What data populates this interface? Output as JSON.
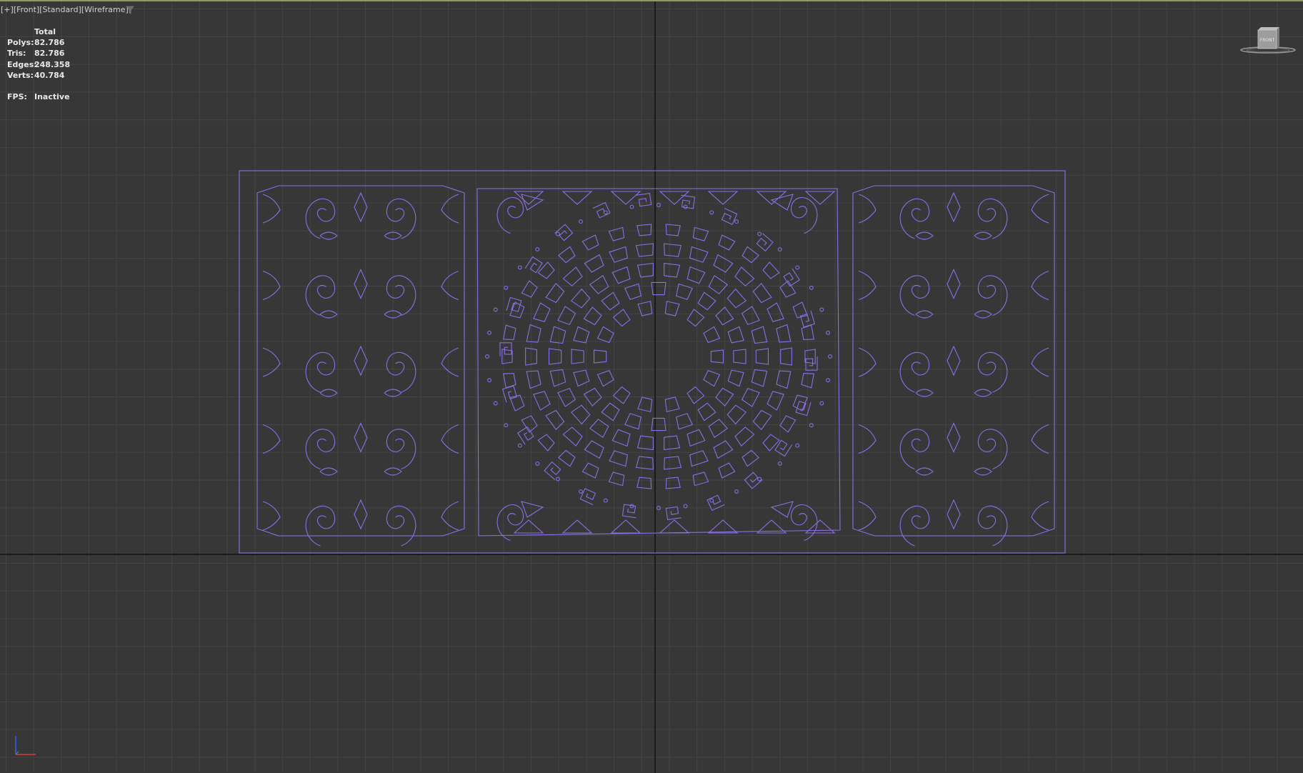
{
  "viewport": {
    "labels": [
      "[+]",
      "[Front]",
      "[Standard]",
      "[Wireframe]"
    ],
    "filter_icon": "funnel-icon"
  },
  "stats": {
    "header": "Total",
    "rows": [
      {
        "label": "Polys:",
        "value": "82.786"
      },
      {
        "label": "Tris:",
        "value": "82.786"
      },
      {
        "label": "Edges:",
        "value": "248.358"
      },
      {
        "label": "Verts:",
        "value": "40.784"
      }
    ],
    "fps_label": "FPS:",
    "fps_value": "Inactive"
  },
  "viewcube": {
    "face_label": "FRONT",
    "icon": "viewcube-icon"
  },
  "tripod": {
    "icon": "axis-tripod-icon"
  },
  "colors": {
    "background": "#373737",
    "grid": "#444444",
    "axis": "#1b1b1b",
    "wireframe": "#8a6fe6",
    "viewport_border": "#8c9a5c"
  }
}
